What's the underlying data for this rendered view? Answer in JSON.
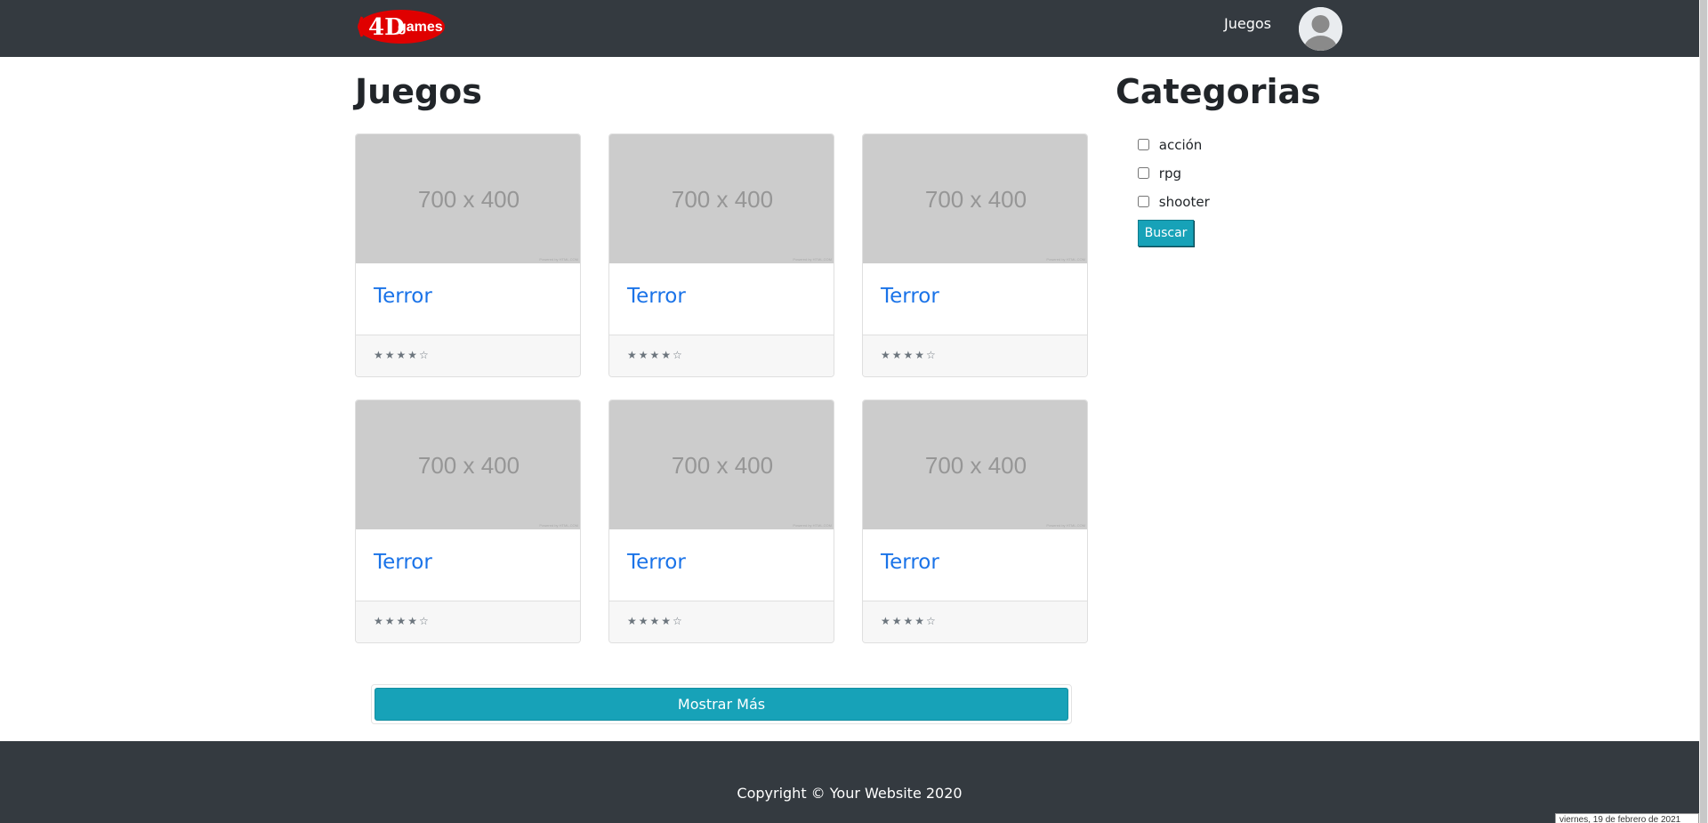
{
  "navbar": {
    "logo": {
      "text_num": "4D",
      "text_word": "games",
      "color": "#e00000"
    },
    "nav_link": "Juegos",
    "avatar_icon": "user-avatar-icon"
  },
  "main": {
    "title": "Juegos",
    "cards": [
      {
        "image_label": "700 x 400",
        "image_credit": "Powered by HTML.COM",
        "title": "Terror",
        "rating": "★★★★☆"
      },
      {
        "image_label": "700 x 400",
        "image_credit": "Powered by HTML.COM",
        "title": "Terror",
        "rating": "★★★★☆"
      },
      {
        "image_label": "700 x 400",
        "image_credit": "Powered by HTML.COM",
        "title": "Terror",
        "rating": "★★★★☆"
      },
      {
        "image_label": "700 x 400",
        "image_credit": "Powered by HTML.COM",
        "title": "Terror",
        "rating": "★★★★☆"
      },
      {
        "image_label": "700 x 400",
        "image_credit": "Powered by HTML.COM",
        "title": "Terror",
        "rating": "★★★★☆"
      },
      {
        "image_label": "700 x 400",
        "image_credit": "Powered by HTML.COM",
        "title": "Terror",
        "rating": "★★★★☆"
      }
    ],
    "show_more_label": "Mostrar Más"
  },
  "sidebar": {
    "title": "Categorias",
    "categories": [
      {
        "label": "acción",
        "checked": false
      },
      {
        "label": "rpg",
        "checked": false
      },
      {
        "label": "shooter",
        "checked": false
      }
    ],
    "search_label": "Buscar"
  },
  "footer": {
    "copyright": "Copyright © Your Website 2020"
  },
  "tooltip": {
    "date": "viernes, 19 de febrero de 2021"
  },
  "colors": {
    "navbar_bg": "#343a40",
    "accent": "#17a2b8",
    "link": "#1a73e8",
    "placeholder_bg": "#cccccc"
  }
}
